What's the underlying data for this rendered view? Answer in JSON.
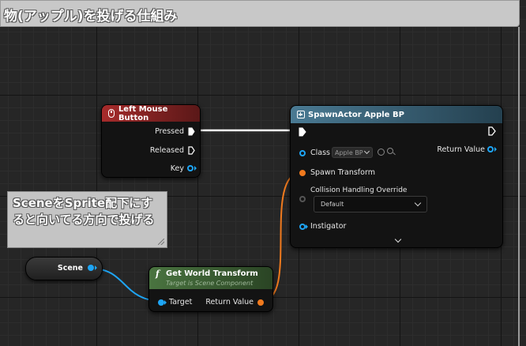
{
  "comment": {
    "title": "物(アップル)を投げる仕組み"
  },
  "note": {
    "text": "SceneをSprite配下にすると向いてる方向で投げる"
  },
  "left_mouse_node": {
    "title": "Left Mouse Button",
    "header_color": "#9c2a2a",
    "pins": {
      "pressed": "Pressed",
      "released": "Released",
      "key": "Key"
    }
  },
  "spawn_node": {
    "title": "SpawnActor Apple BP",
    "header_color": "#3d6b84",
    "class_label": "Class",
    "class_value": "Apple BP",
    "return_value": "Return Value",
    "spawn_transform": "Spawn Transform",
    "collision_label": "Collision Handling Override",
    "collision_value": "Default",
    "instigator": "Instigator"
  },
  "scene_node": {
    "label": "Scene"
  },
  "transform_node": {
    "title": "Get World Transform",
    "subtitle": "Target is Scene Component",
    "header_color": "#3e5e34",
    "target": "Target",
    "return_value": "Return Value"
  },
  "icons": [
    "mouse-icon",
    "spawn-icon",
    "function-icon",
    "search-icon",
    "use-selected-icon",
    "chevron-down-icon"
  ],
  "colors": {
    "exec": "#ffffff",
    "object_pin": "#1ea5f5",
    "transform_pin": "#f07a1e"
  }
}
